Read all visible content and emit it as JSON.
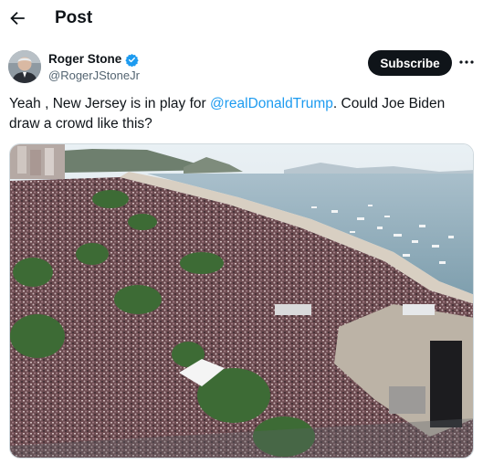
{
  "header": {
    "title": "Post",
    "back_icon": "arrow-left-icon"
  },
  "author": {
    "name": "Roger Stone",
    "handle": "@RogerJStoneJr",
    "verified_color": "#1d9bf0"
  },
  "actions": {
    "subscribe_label": "Subscribe",
    "more_icon": "ellipsis-icon"
  },
  "tweet": {
    "text_before": "Yeah , New Jersey is in play for ",
    "mention": "@realDonaldTrump",
    "text_after": ". Could Joe Biden draw a crowd like this?"
  },
  "colors": {
    "accent": "#1d9bf0",
    "text": "#0f1419",
    "muted": "#536471",
    "button": "#0f1419"
  }
}
